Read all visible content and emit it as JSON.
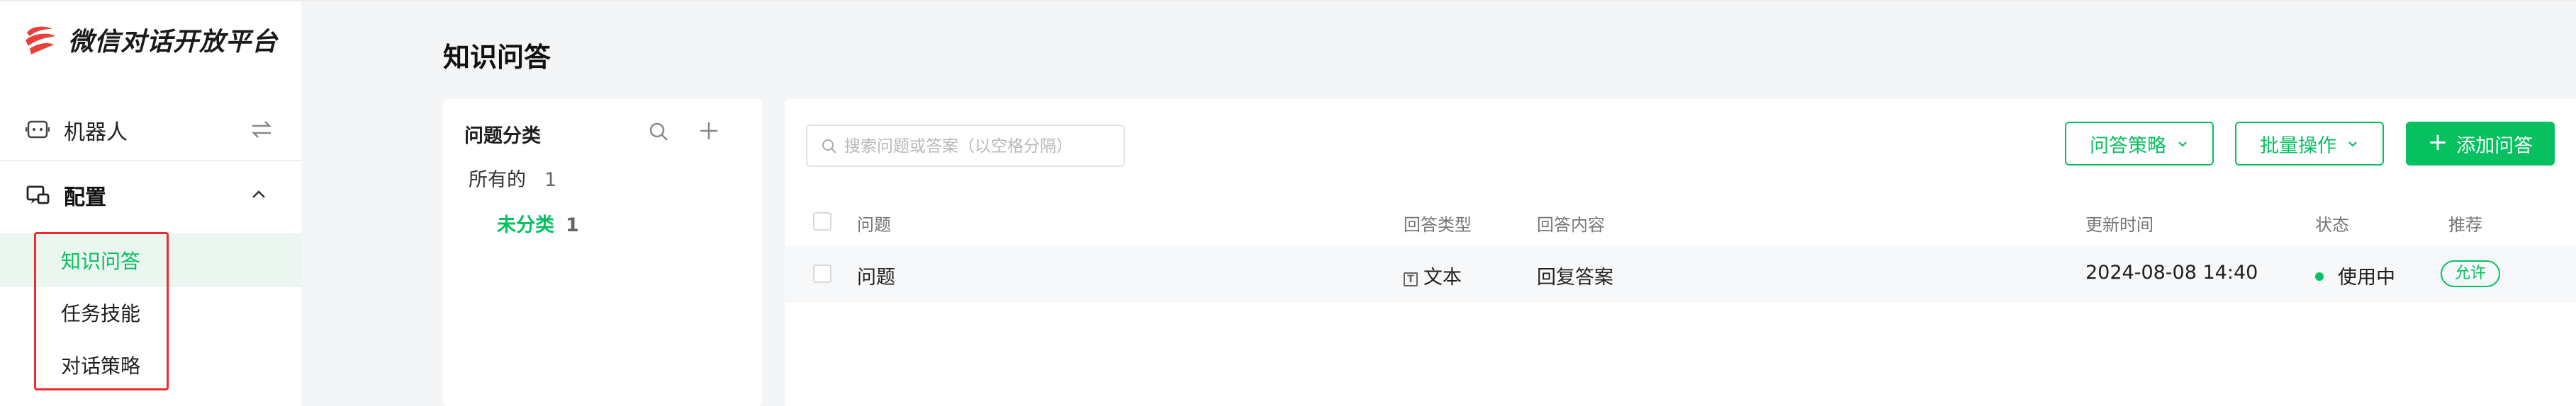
{
  "app": {
    "logo_text": "微信对话开放平台"
  },
  "sidebar": {
    "robot_label": "机器人",
    "config_label": "配置",
    "sub_items": [
      {
        "label": "知识问答",
        "active": true
      },
      {
        "label": "任务技能",
        "active": false
      },
      {
        "label": "对话策略",
        "active": false
      }
    ]
  },
  "page": {
    "title": "知识问答"
  },
  "categories": {
    "title": "问题分类",
    "all_label": "所有的",
    "all_count": "1",
    "uncategorized_label": "未分类",
    "uncategorized_count": "1"
  },
  "toolbar": {
    "search_placeholder": "搜索问题或答案（以空格分隔）",
    "strategy_label": "问答策略",
    "batch_label": "批量操作",
    "add_label": "添加问答"
  },
  "table": {
    "headers": {
      "question": "问题",
      "answer_type": "回答类型",
      "answer_content": "回答内容",
      "updated": "更新时间",
      "status": "状态",
      "recommend": "推荐"
    },
    "rows": [
      {
        "question": "问题",
        "answer_type": "文本",
        "answer_content": "回复答案",
        "updated": "2024-08-08 14:40",
        "status": "使用中",
        "recommend": "允许"
      }
    ]
  },
  "colors": {
    "accent": "#07c160",
    "highlight_box": "#ee2b2b",
    "logo_red": "#e8413a"
  }
}
